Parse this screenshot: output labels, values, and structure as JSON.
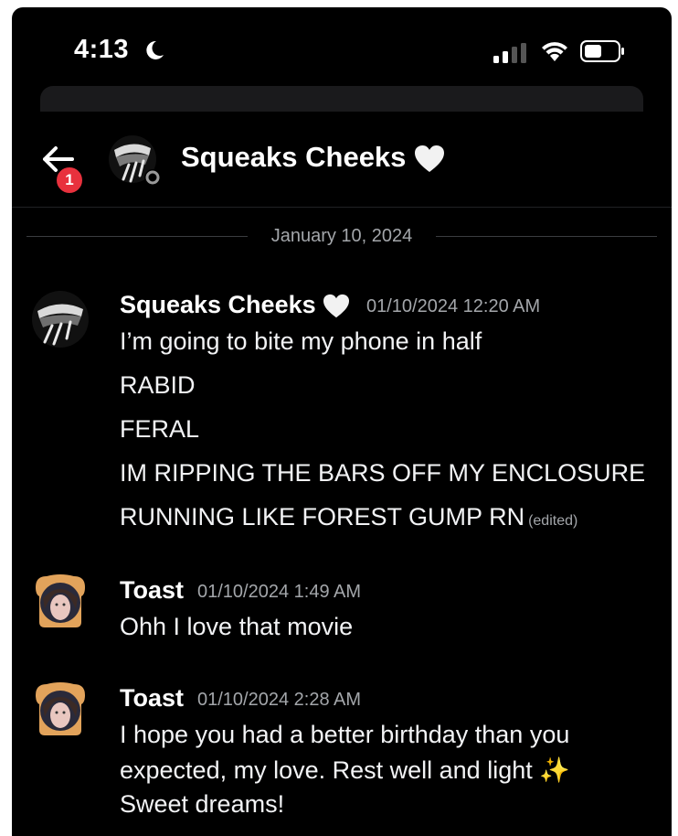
{
  "status_bar": {
    "time": "4:13"
  },
  "header": {
    "title": "Squeaks Cheeks",
    "badge_count": "1"
  },
  "date_divider": "January 10, 2024",
  "messages": [
    {
      "author": "Squeaks Cheeks",
      "timestamp": "01/10/2024 12:20 AM",
      "lines": [
        "I’m going to bite my phone in half",
        "RABID",
        "FERAL",
        "IM RIPPING THE BARS OFF MY ENCLOSURE",
        "RUNNING LIKE FOREST GUMP RN"
      ],
      "edited_label": "(edited)"
    },
    {
      "author": "Toast",
      "timestamp": "01/10/2024 1:49 AM",
      "lines": [
        "Ohh I love that movie"
      ]
    },
    {
      "author": "Toast",
      "timestamp": "01/10/2024 2:28 AM",
      "lines": [
        "I hope you had a better birthday than you",
        "expected, my love. Rest well and light ✨",
        "Sweet dreams!"
      ]
    }
  ],
  "colors": {
    "background": "#000000",
    "muted_text": "#a3a6aa",
    "badge": "#e8313d"
  }
}
